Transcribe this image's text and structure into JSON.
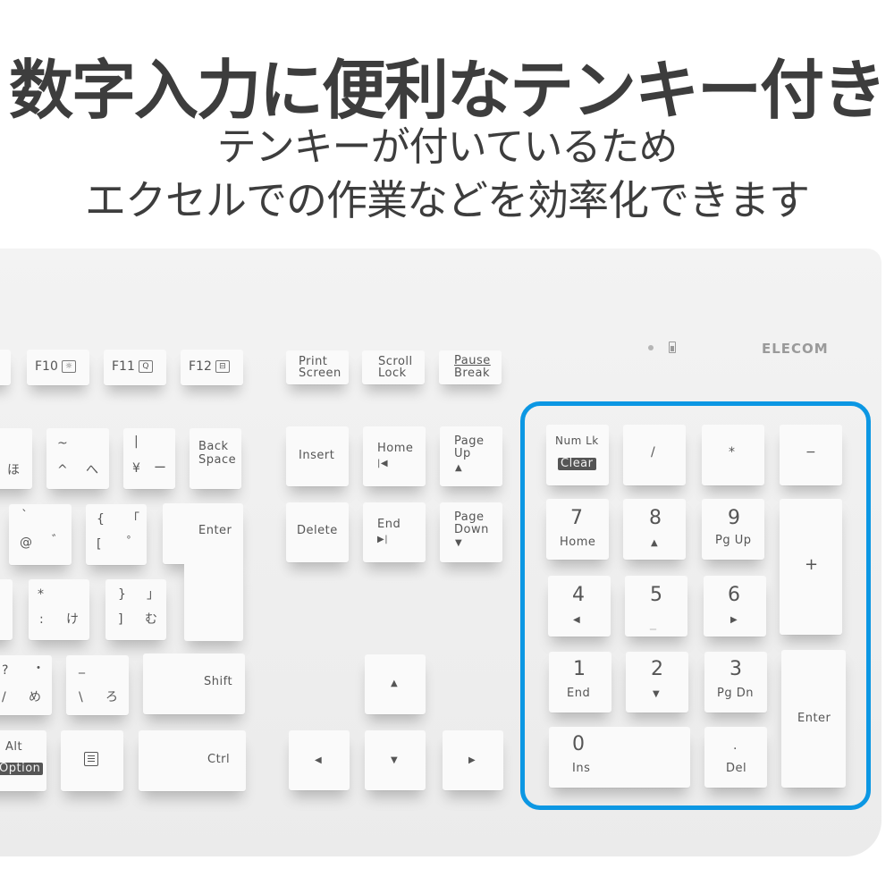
{
  "headline": {
    "title": "数字入力に便利なテンキー付き",
    "line2": "テンキーが付いているため",
    "line3": "エクセルでの作業などを効率化できます"
  },
  "brand": {
    "logo": "ELECOM",
    "accent_color": "#0c97e3",
    "indicators": [
      "status-led",
      "battery-icon"
    ]
  },
  "function_row": [
    {
      "label": "F10",
      "icon": "brightness-icon",
      "glyph": "☼"
    },
    {
      "label": "F11",
      "icon": "search-icon",
      "glyph": "Q"
    },
    {
      "label": "F12",
      "icon": "window-switch-icon",
      "glyph": "⊟"
    }
  ],
  "system_keys": {
    "print": [
      "Print",
      "Screen"
    ],
    "scroll": [
      "Scroll",
      "Lock"
    ],
    "pause": [
      "Pause",
      "Break"
    ]
  },
  "main_keys": {
    "ho": "ほ",
    "caret": {
      "top": "~",
      "bl": "^",
      "br": "へ"
    },
    "yen": {
      "top": "|",
      "bl": "¥",
      "br": "ー"
    },
    "backspace": [
      "Back",
      "Space"
    ],
    "at": {
      "top": "`",
      "bl": "@",
      "br": "゛"
    },
    "bracket": {
      "tl": "{",
      "tr": "「",
      "bl": "[",
      "br": "゜"
    },
    "enter": "Enter",
    "colon": {
      "top": "*",
      "bl": ":",
      "br": "け"
    },
    "rbracket": {
      "tl": "}",
      "tr": "」",
      "bl": "]",
      "br": "む"
    },
    "slash": {
      "tl": "?",
      "tr": "・",
      "bl": "/",
      "br": "め"
    },
    "backslash": {
      "top": "_",
      "bl": "\\",
      "br": "ろ"
    },
    "shift": "Shift",
    "alt": "Alt",
    "option": "Option",
    "menu_icon": "menu-icon",
    "ctrl": "Ctrl"
  },
  "nav_keys": {
    "insert": "Insert",
    "home": "Home",
    "page_up": [
      "Page",
      "Up"
    ],
    "delete": "Delete",
    "end": "End",
    "page_down": [
      "Page",
      "Down"
    ],
    "home_glyph": "|◀",
    "end_glyph": "▶|",
    "up": "▲",
    "down": "▼",
    "left": "◀",
    "right": "▶"
  },
  "numpad": {
    "numlock": "Num Lk",
    "clear": "Clear",
    "divide": "/",
    "multiply": "*",
    "minus": "−",
    "plus": "+",
    "enter": "Enter",
    "keys": [
      {
        "digit": "7",
        "sub": "Home"
      },
      {
        "digit": "8",
        "sub": "▲"
      },
      {
        "digit": "9",
        "sub": "Pg Up"
      },
      {
        "digit": "4",
        "sub": "◀"
      },
      {
        "digit": "5",
        "sub": "_"
      },
      {
        "digit": "6",
        "sub": "▶"
      },
      {
        "digit": "1",
        "sub": "End"
      },
      {
        "digit": "2",
        "sub": "▼"
      },
      {
        "digit": "3",
        "sub": "Pg Dn"
      },
      {
        "digit": "0",
        "sub": "Ins"
      },
      {
        "digit": ".",
        "sub": "Del"
      }
    ]
  }
}
